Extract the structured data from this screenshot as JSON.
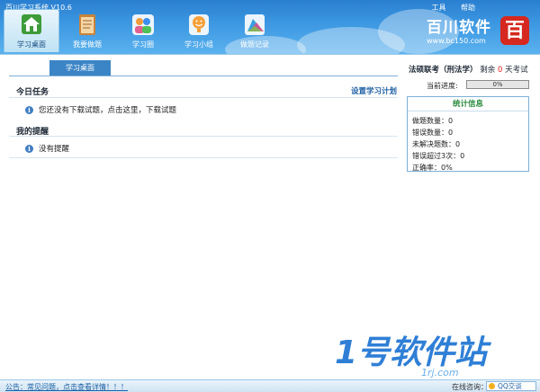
{
  "window": {
    "title": "百川学习系统 V10.6",
    "links": [
      "工具",
      "帮助"
    ]
  },
  "nav": {
    "items": [
      {
        "label": "学习桌面",
        "icon": "home-icon",
        "active": true
      },
      {
        "label": "我要做题",
        "icon": "notepad-icon",
        "active": false
      },
      {
        "label": "学习圈",
        "icon": "people-icon",
        "active": false
      },
      {
        "label": "学习小组",
        "icon": "smiley-group-icon",
        "active": false
      },
      {
        "label": "做题记录",
        "icon": "chart-record-icon",
        "active": false
      }
    ]
  },
  "brand": {
    "name": "百川软件",
    "url": "www.bc150.com",
    "logo_char": "百"
  },
  "main": {
    "tab_label": "学习桌面",
    "today_title": "今日任务",
    "plan_link": "设置学习计划",
    "today_items": [
      "您还没有下载试题，点击这里，下载试题"
    ],
    "reminder_title": "我的提醒",
    "reminder_items": [
      "没有提醒"
    ]
  },
  "exam": {
    "name": "法硕联考（刑法学）",
    "prefix": "剩余",
    "days": "0",
    "suffix": "天考试",
    "progress_label": "当前进度:",
    "progress_text": "0%",
    "progress_value": 0
  },
  "stats": {
    "title": "统计信息",
    "items": [
      "做题数量：0",
      "错误数量：0",
      "未解决题数：0",
      "错误超过3次：0",
      "正确率：0%"
    ]
  },
  "watermark": {
    "text": "1号软件站",
    "url": "1rj.com"
  },
  "status": {
    "notice": "公告：常见问题，点击查看详情！！！",
    "online_label": "在线咨询：",
    "qq_label": "QQ交谈"
  },
  "colors": {
    "header_blue": "#3d98e2",
    "accent_red": "#e21b1b",
    "stats_green": "#2b8a3e",
    "link_blue": "#1d5fa3"
  }
}
